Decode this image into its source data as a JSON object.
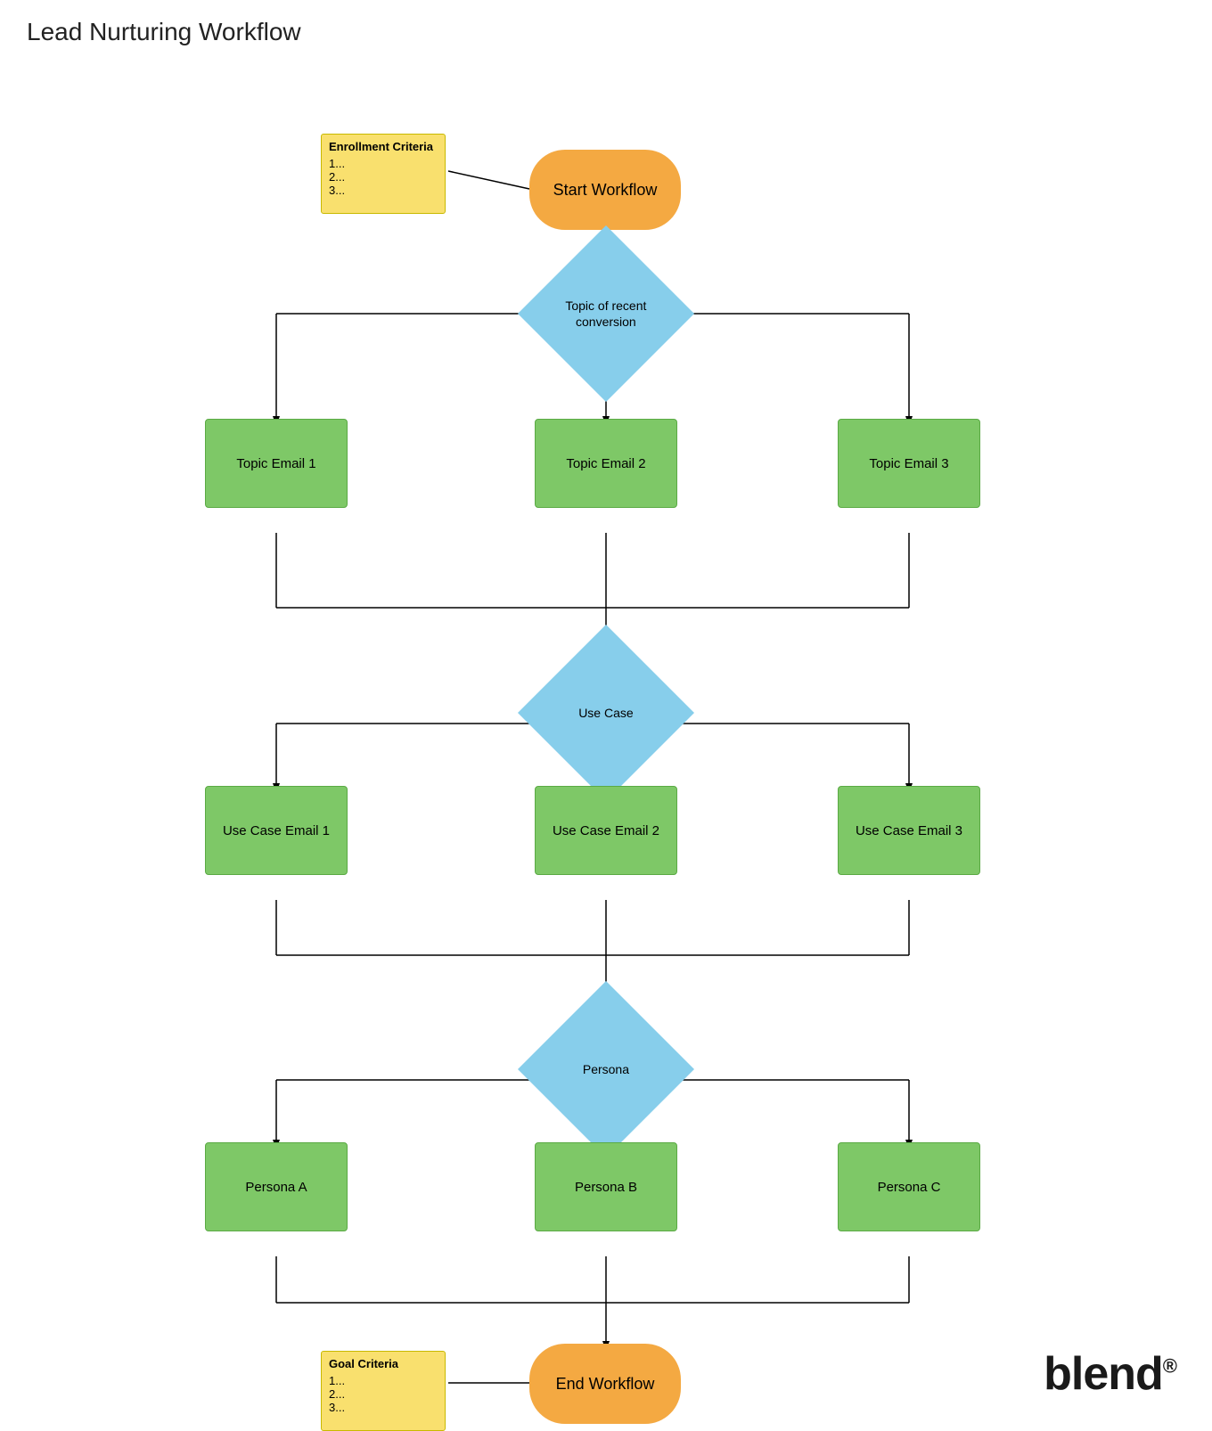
{
  "title": "Lead Nurturing Workflow",
  "nodes": {
    "start": {
      "label": "Start Workflow"
    },
    "end": {
      "label": "End Workflow"
    },
    "diamond1": {
      "label": "Topic of recent conversion"
    },
    "diamond2": {
      "label": "Use Case"
    },
    "diamond3": {
      "label": "Persona"
    },
    "topicEmail1": {
      "label": "Topic Email 1"
    },
    "topicEmail2": {
      "label": "Topic Email 2"
    },
    "topicEmail3": {
      "label": "Topic Email 3"
    },
    "useCaseEmail1": {
      "label": "Use Case Email 1"
    },
    "useCaseEmail2": {
      "label": "Use Case Email 2"
    },
    "useCaseEmail3": {
      "label": "Use Case Email 3"
    },
    "personaA": {
      "label": "Persona A"
    },
    "personaB": {
      "label": "Persona B"
    },
    "personaC": {
      "label": "Persona C"
    },
    "enrollmentNote": {
      "title": "Enrollment Criteria",
      "lines": [
        "1...",
        "2...",
        "3..."
      ]
    },
    "goalNote": {
      "title": "Goal Criteria",
      "lines": [
        "1...",
        "2...",
        "3..."
      ]
    }
  },
  "brand": {
    "text": "blend",
    "suffix": "®"
  }
}
